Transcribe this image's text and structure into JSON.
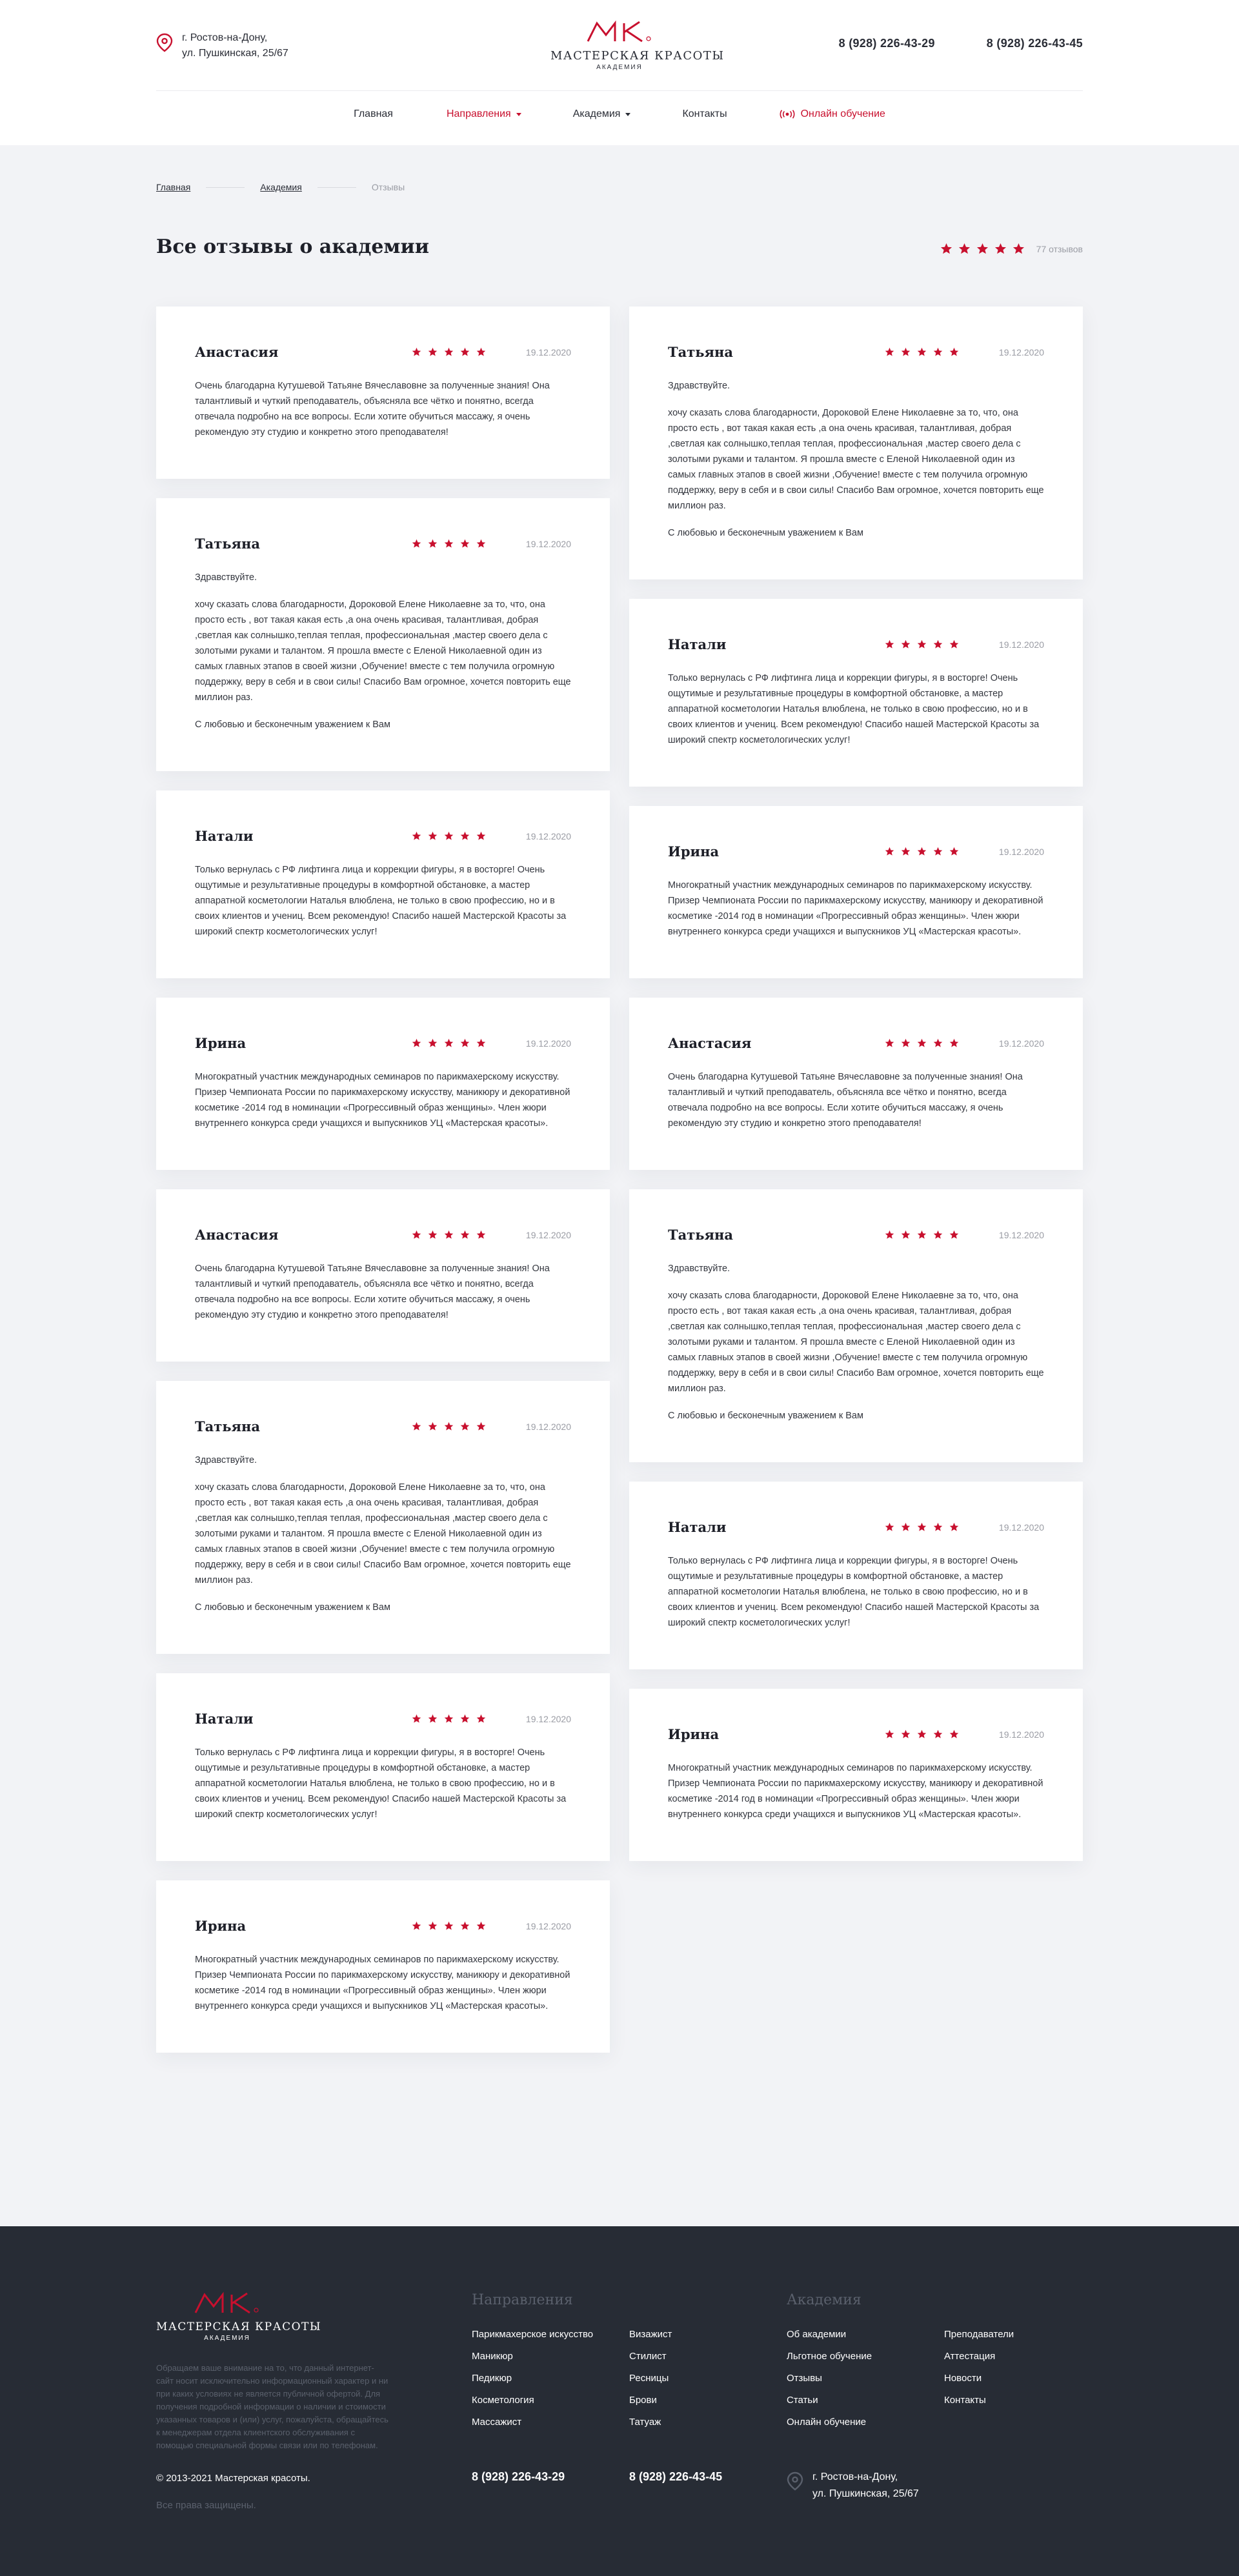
{
  "header": {
    "address_line1": "г. Ростов-на-Дону,",
    "address_line2": "ул. Пушкинская, 25/67",
    "logo_title": "МАСТЕРСКАЯ КРАСОТЫ",
    "logo_sub": "АКАДЕМИЯ",
    "phone1": "8 (928) 226-43-29",
    "phone2": "8 (928) 226-43-45",
    "brand_color": "#c8102e"
  },
  "nav": {
    "home": "Главная",
    "directions": "Направления",
    "academy": "Академия",
    "contacts": "Контакты",
    "online": "Онлайн обучение"
  },
  "breadcrumb": {
    "home": "Главная",
    "academy": "Академия",
    "current": "Отзывы"
  },
  "page": {
    "title": "Все отзывы о академии",
    "reviews_count": "77 отзывов",
    "rating_stars": 5
  },
  "reviews_left": [
    {
      "name": "Анастасия",
      "date": "19.12.2020",
      "stars": 5,
      "paragraphs": [
        "Очень благодарна Кутушевой Татьяне Вячеславовне за полученные знания! Она талантливый и чуткий преподаватель, объясняла все чётко и понятно, всегда отвечала подробно на все вопросы. Если хотите обучиться массажу, я очень рекомендую эту студию и конкретно этого преподавателя!"
      ]
    },
    {
      "name": "Татьяна",
      "date": "19.12.2020",
      "stars": 5,
      "paragraphs": [
        "Здравствуйте.",
        "хочу сказать слова благодарности, Дороковой Елене Николаевне за то, что, она просто есть , вот такая какая есть ,а она очень красивая, талантливая, добрая ,светлая как солнышко,теплая теплая, профессиональная ,мастер своего дела с золотыми руками и талантом. Я прошла вместе с Еленой Николаевной один из самых главных этапов в своей жизни ,Обучение! вместе с тем получила огромную поддержку, веру в себя и в свои силы! Спасибо Вам огромное, хочется повторить еще миллион раз.",
        "С любовью и бесконечным уважением к Вам"
      ]
    },
    {
      "name": "Натали",
      "date": "19.12.2020",
      "stars": 5,
      "paragraphs": [
        "Только вернулась с РФ лифтинга лица и коррекции фигуры, я в восторге! Очень ощутимые и результативные процедуры в комфортной обстановке, а мастер аппаратной косметологии Наталья влюблена, не только в свою профессию, но и в своих клиентов и учениц. Всем рекомендую! Спасибо нашей Мастерской Красоты за широкий спектр косметологических услуг!"
      ]
    },
    {
      "name": "Ирина",
      "date": "19.12.2020",
      "stars": 5,
      "paragraphs": [
        "Многократный участник международных семинаров по парикмахерскому искусству. Призер Чемпионата России по парикмахерскому искусству, маникюру и декоративной косметике -2014 год в номинации «Прогрессивный образ женщины». Член жюри внутреннего конкурса среди учащихся и выпускников УЦ «Мастерская красоты»."
      ]
    },
    {
      "name": "Анастасия",
      "date": "19.12.2020",
      "stars": 5,
      "paragraphs": [
        "Очень благодарна Кутушевой Татьяне Вячеславовне за полученные знания! Она талантливый и чуткий преподаватель, объясняла все чётко и понятно, всегда отвечала подробно на все вопросы. Если хотите обучиться массажу, я очень рекомендую эту студию и конкретно этого преподавателя!"
      ]
    },
    {
      "name": "Татьяна",
      "date": "19.12.2020",
      "stars": 5,
      "paragraphs": [
        "Здравствуйте.",
        "хочу сказать слова благодарности, Дороковой Елене Николаевне за то, что, она просто есть , вот такая какая есть ,а она очень красивая, талантливая, добрая ,светлая как солнышко,теплая теплая, профессиональная ,мастер своего дела с золотыми руками и талантом. Я прошла вместе с Еленой Николаевной один из самых главных этапов в своей жизни ,Обучение! вместе с тем получила огромную поддержку, веру в себя и в свои силы! Спасибо Вам огромное, хочется повторить еще миллион раз.",
        "С любовью и бесконечным уважением к Вам"
      ]
    },
    {
      "name": "Натали",
      "date": "19.12.2020",
      "stars": 5,
      "paragraphs": [
        "Только вернулась с РФ лифтинга лица и коррекции фигуры, я в восторге! Очень ощутимые и результативные процедуры в комфортной обстановке, а мастер аппаратной косметологии Наталья влюблена, не только в свою профессию, но и в своих клиентов и учениц. Всем рекомендую! Спасибо нашей Мастерской Красоты за широкий спектр косметологических услуг!"
      ]
    },
    {
      "name": "Ирина",
      "date": "19.12.2020",
      "stars": 5,
      "paragraphs": [
        "Многократный участник международных семинаров по парикмахерскому искусству. Призер Чемпионата России по парикмахерскому искусству, маникюру и декоративной косметике -2014 год в номинации «Прогрессивный образ женщины». Член жюри внутреннего конкурса среди учащихся и выпускников УЦ «Мастерская красоты»."
      ]
    }
  ],
  "reviews_right": [
    {
      "name": "Татьяна",
      "date": "19.12.2020",
      "stars": 5,
      "paragraphs": [
        "Здравствуйте.",
        "хочу сказать слова благодарности, Дороковой Елене Николаевне за то, что, она просто есть , вот такая какая есть ,а она очень красивая, талантливая, добрая ,светлая как солнышко,теплая теплая, профессиональная ,мастер своего дела с золотыми руками и талантом. Я прошла вместе с Еленой Николаевной один из самых главных этапов в своей жизни ,Обучение! вместе с тем получила огромную поддержку, веру в себя и в свои силы! Спасибо Вам огромное, хочется повторить еще миллион раз.",
        "С любовью и бесконечным уважением к Вам"
      ]
    },
    {
      "name": "Натали",
      "date": "19.12.2020",
      "stars": 5,
      "paragraphs": [
        "Только вернулась с РФ лифтинга лица и коррекции фигуры, я в восторге! Очень ощутимые и результативные процедуры в комфортной обстановке, а мастер аппаратной косметологии Наталья влюблена, не только в свою профессию, но и в своих клиентов и учениц. Всем рекомендую! Спасибо нашей Мастерской Красоты за широкий спектр косметологических услуг!"
      ]
    },
    {
      "name": "Ирина",
      "date": "19.12.2020",
      "stars": 5,
      "paragraphs": [
        "Многократный участник международных семинаров по парикмахерскому искусству. Призер Чемпионата России по парикмахерскому искусству, маникюру и декоративной косметике -2014 год в номинации «Прогрессивный образ женщины». Член жюри внутреннего конкурса среди учащихся и выпускников УЦ «Мастерская красоты»."
      ]
    },
    {
      "name": "Анастасия",
      "date": "19.12.2020",
      "stars": 5,
      "paragraphs": [
        "Очень благодарна Кутушевой Татьяне Вячеславовне за полученные знания! Она талантливый и чуткий преподаватель, объясняла все чётко и понятно, всегда отвечала подробно на все вопросы. Если хотите обучиться массажу, я очень рекомендую эту студию и конкретно этого преподавателя!"
      ]
    },
    {
      "name": "Татьяна",
      "date": "19.12.2020",
      "stars": 5,
      "paragraphs": [
        "Здравствуйте.",
        "хочу сказать слова благодарности, Дороковой Елене Николаевне за то, что, она просто есть , вот такая какая есть ,а она очень красивая, талантливая, добрая ,светлая как солнышко,теплая теплая, профессиональная ,мастер своего дела с золотыми руками и талантом. Я прошла вместе с Еленой Николаевной один из самых главных этапов в своей жизни ,Обучение! вместе с тем получила огромную поддержку, веру в себя и в свои силы! Спасибо Вам огромное, хочется повторить еще миллион раз.",
        "С любовью и бесконечным уважением к Вам"
      ]
    },
    {
      "name": "Натали",
      "date": "19.12.2020",
      "stars": 5,
      "paragraphs": [
        "Только вернулась с РФ лифтинга лица и коррекции фигуры, я в восторге! Очень ощутимые и результативные процедуры в комфортной обстановке, а мастер аппаратной косметологии Наталья влюблена, не только в свою профессию, но и в своих клиентов и учениц. Всем рекомендую! Спасибо нашей Мастерской Красоты за широкий спектр косметологических услуг!"
      ]
    },
    {
      "name": "Ирина",
      "date": "19.12.2020",
      "stars": 5,
      "paragraphs": [
        "Многократный участник международных семинаров по парикмахерскому искусству. Призер Чемпионата России по парикмахерскому искусству, маникюру и декоративной косметике -2014 год в номинации «Прогрессивный образ женщины». Член жюри внутреннего конкурса среди учащихся и выпускников УЦ «Мастерская красоты»."
      ]
    }
  ],
  "footer": {
    "logo_title": "МАСТЕРСКАЯ КРАСОТЫ",
    "logo_sub": "АКАДЕМИЯ",
    "disclaimer": "Обращаем ваше внимание на то, что данный интернет-сайт носит исключительно информационный характер и ни при каких условиях не является публичной офертой. Для получения подробной информации о наличии и стоимости указанных товаров и (или) услуг, пожалуйста, обращайтесь к менеджерам отдела клиентского обслуживания с помощью специальной формы связи или по телефонам.",
    "copyright": "© 2013-2021 Мастерская красоты.",
    "rights": "Все права защищены.",
    "directions_title": "Направления",
    "directions_col1": [
      "Парикмахерское искусство",
      "Маникюр",
      "Педикюр",
      "Косметология",
      "Массажист"
    ],
    "directions_col2": [
      "Визажист",
      "Стилист",
      "Ресницы",
      "Брови",
      "Татуаж"
    ],
    "academy_title": "Академия",
    "academy_col1": [
      "Об академии",
      "Льготное обучение",
      "Отзывы",
      "Статьи",
      "Онлайн обучение"
    ],
    "academy_col2": [
      "Преподаватели",
      "Аттестация",
      "Новости",
      "Контакты"
    ],
    "phone1": "8 (928) 226-43-29",
    "phone2": "8 (928) 226-43-45",
    "address_line1": "г. Ростов-на-Дону,",
    "address_line2": "ул. Пушкинская, 25/67"
  }
}
